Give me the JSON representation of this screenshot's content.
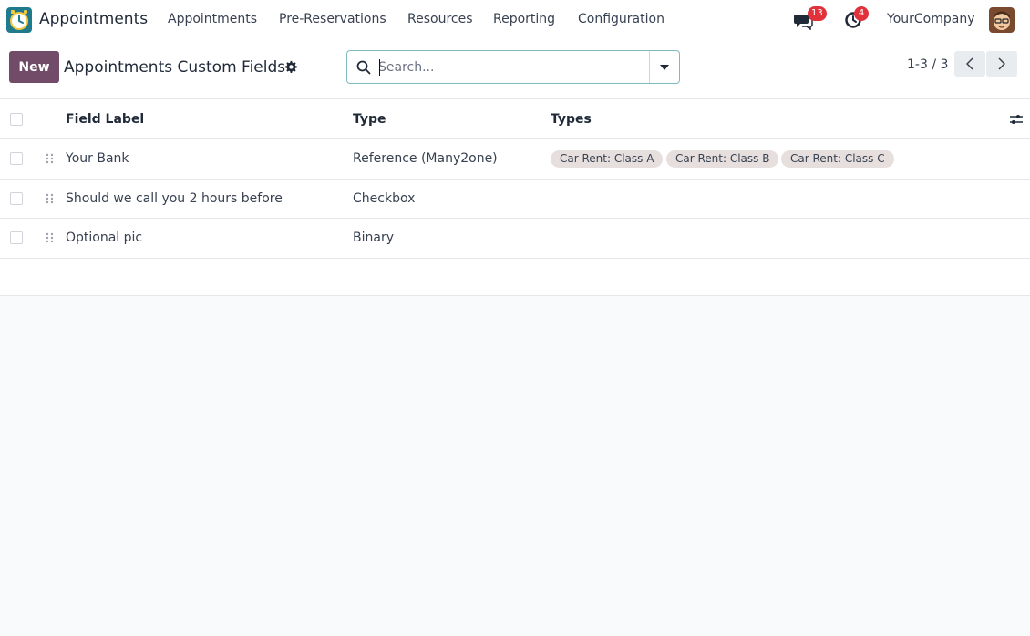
{
  "navbar": {
    "app_name": "Appointments",
    "menus": [
      "Appointments",
      "Pre-Reservations",
      "Resources",
      "Reporting",
      "Configuration"
    ],
    "messages_count": "13",
    "activities_count": "4",
    "company": "YourCompany"
  },
  "control": {
    "new_label": "New",
    "title": "Appointments Custom Fields",
    "search_placeholder": "Search...",
    "pager": "1-3 / 3"
  },
  "list": {
    "columns": [
      "Field Label",
      "Type",
      "Types"
    ],
    "rows": [
      {
        "label": "Your Bank",
        "type": "Reference (Many2one)",
        "tags": [
          "Car Rent: Class A",
          "Car Rent: Class B",
          "Car Rent: Class C"
        ]
      },
      {
        "label": "Should we call you 2 hours before",
        "type": "Checkbox",
        "tags": []
      },
      {
        "label": "Optional pic",
        "type": "Binary",
        "tags": []
      }
    ]
  },
  "colors": {
    "primary": "#714b67",
    "badge": "#e1313b",
    "tag_bg": "#e7dfdd",
    "search_border": "#7dbbc1"
  }
}
